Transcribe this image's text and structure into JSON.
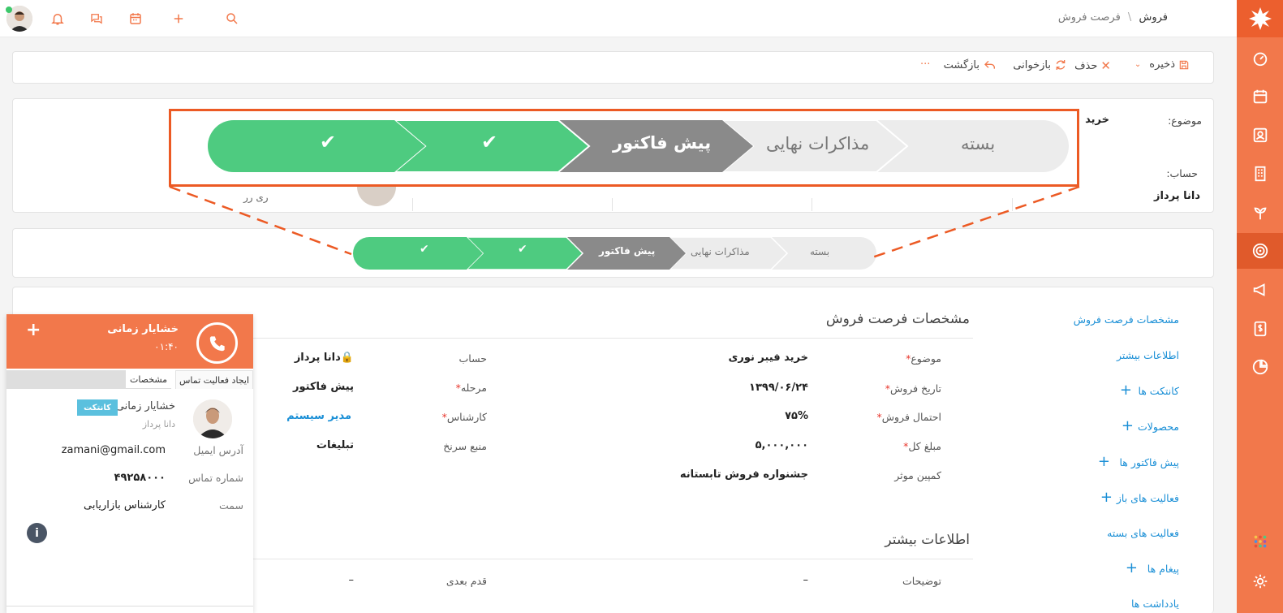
{
  "breadcrumb": {
    "root": "فروش",
    "sep": "\\",
    "current": "فرصت فروش"
  },
  "toolbar": {
    "save": "ذخیره",
    "delete": "حذف",
    "reload": "بازخوانی",
    "back": "بازگشت",
    "more": "···"
  },
  "summary": {
    "subject_label": "موضوع:",
    "subject_value": "خرید",
    "account_label": "حساب:",
    "account_value": "دانا پرداز",
    "obscured_text": "ری رر"
  },
  "stages": {
    "closed": "بسته",
    "final": "مذاکرات نهایی",
    "proforma": "پیش فاکتور",
    "check": "✔"
  },
  "nav": {
    "details": "مشخصات فرصت فروش",
    "more": "اطلاعات بیشتر",
    "contacts": "کانتکت ها",
    "products": "محصولات",
    "proformas": "پیش فاکتور ها",
    "open_activities": "فعالیت های باز",
    "closed_activities": "فعالیت های بسته",
    "messages": "پیغام ها",
    "notes": "یادداشت ها",
    "plus": "+"
  },
  "details": {
    "section_title": "مشخصات فرصت فروش",
    "subject_label": "موضوع",
    "subject_value": "خرید فیبر نوری",
    "date_label": "تاریخ فروش",
    "date_value": "۱۳۹۹/۰۶/۲۴",
    "prob_label": "احتمال فروش",
    "prob_value": "۷۵%",
    "amount_label": "مبلغ کل",
    "amount_value": "۵,۰۰۰,۰۰۰",
    "campaign_label": "کمپین موثر",
    "campaign_value": "جشنواره فروش تابستانه",
    "account_label": "حساب",
    "account_value": "دانا پرداز",
    "stage_label": "مرحله",
    "stage_value": "پیش فاکتور",
    "expert_label": "کارشناس",
    "expert_value": "مدیر سیستم",
    "source_label": "منبع سرنخ",
    "source_value": "تبلیغات",
    "required_mark": "*"
  },
  "more_info": {
    "section_title": "اطلاعات بیشتر",
    "desc_label": "توضیحات",
    "desc_value": "–",
    "next_label": "قدم بعدی",
    "next_value": "–"
  },
  "call": {
    "name": "خشایار زمانی",
    "timer": "۰۱:۴۰",
    "plus": "+",
    "tab_details": "مشخصات",
    "tab_activity": "ایجاد فعالیت تماس",
    "contact_name": "خشایار زمانی",
    "badge": "کانتکت",
    "company": "دانا پرداز",
    "email_label": "آدرس ایمیل",
    "email_value": "zamani@gmail.com",
    "phone_label": "شماره تماس",
    "phone_value": "۴۹۲۵۸۰۰۰",
    "role_label": "سمت",
    "role_value": "کارشناس بازاریابی",
    "info": "i"
  },
  "colors": {
    "accent": "#f2784b",
    "green": "#4ecb80",
    "gray_stage": "#8a8a8a",
    "light_stage": "#ececec",
    "link": "#1a8fd6",
    "highlight": "#ec5a24"
  }
}
